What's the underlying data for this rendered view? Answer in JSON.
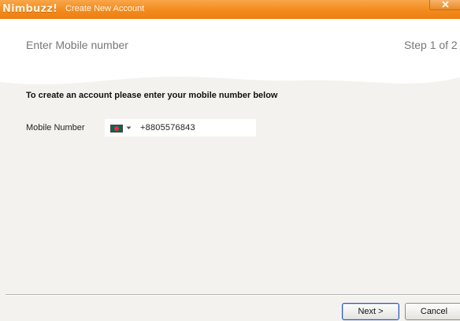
{
  "titlebar": {
    "brand": "Nimbuzz!",
    "title": "Create New Account",
    "close_icon": "close-icon"
  },
  "header": {
    "title": "Enter Mobile number",
    "step": "Step 1 of 2"
  },
  "content": {
    "instruction": "To create an account please enter your mobile number below",
    "mobile_label": "Mobile Number",
    "country_flag": "bangladesh-flag-icon",
    "phone_value": "+8805576843"
  },
  "footer": {
    "next_label": "Next >",
    "cancel_label": "Cancel"
  },
  "colors": {
    "titlebar": "#f28a1c",
    "background": "#f3f2ee",
    "header": "#ffffff",
    "default_button_border": "#2d55b5"
  }
}
